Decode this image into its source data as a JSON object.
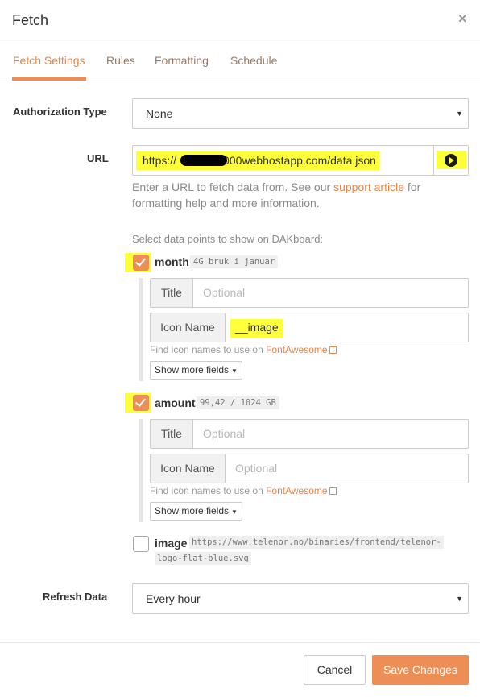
{
  "modal": {
    "title": "Fetch",
    "close": "×"
  },
  "tabs": [
    {
      "label": "Fetch Settings",
      "active": true
    },
    {
      "label": "Rules"
    },
    {
      "label": "Formatting"
    },
    {
      "label": "Schedule"
    }
  ],
  "form": {
    "auth_label": "Authorization Type",
    "auth_value": "None",
    "url_label": "URL",
    "url_value": "https://",
    "url_value_tail": "000webhostapp.com/data.json",
    "help_prefix": "Enter a URL to fetch data from. See our ",
    "help_link": "support article",
    "help_suffix": " for formatting help and more information.",
    "datapoints_hint": "Select data points to show on DAKboard:",
    "refresh_label": "Refresh Data",
    "refresh_value": "Every hour"
  },
  "datapoints": [
    {
      "name": "month",
      "sample": "4G bruk i januar",
      "checked": true,
      "title_label": "Title",
      "title_placeholder": "Optional",
      "icon_label": "Icon Name",
      "icon_value": "__image",
      "find_prefix": "Find icon names to use on ",
      "find_link": "FontAwesome",
      "more_label": "Show more fields"
    },
    {
      "name": "amount",
      "sample": "99,42 / 1024 GB",
      "checked": true,
      "title_label": "Title",
      "title_placeholder": "Optional",
      "icon_label": "Icon Name",
      "icon_placeholder": "Optional",
      "find_prefix": "Find icon names to use on ",
      "find_link": "FontAwesome",
      "more_label": "Show more fields"
    },
    {
      "name": "image",
      "sample_line1": "https://www.telenor.no/binaries/frontend/telenor-",
      "sample_line2": "logo-flat-blue.svg",
      "checked": false
    }
  ],
  "footer": {
    "cancel": "Cancel",
    "save": "Save Changes"
  },
  "icons": {
    "play": "play-circle-icon",
    "caret": "caret-down-icon",
    "check": "check-icon",
    "external": "external-link-icon"
  },
  "colors": {
    "accent": "#ee8e57",
    "highlight": "#ffff3a"
  }
}
